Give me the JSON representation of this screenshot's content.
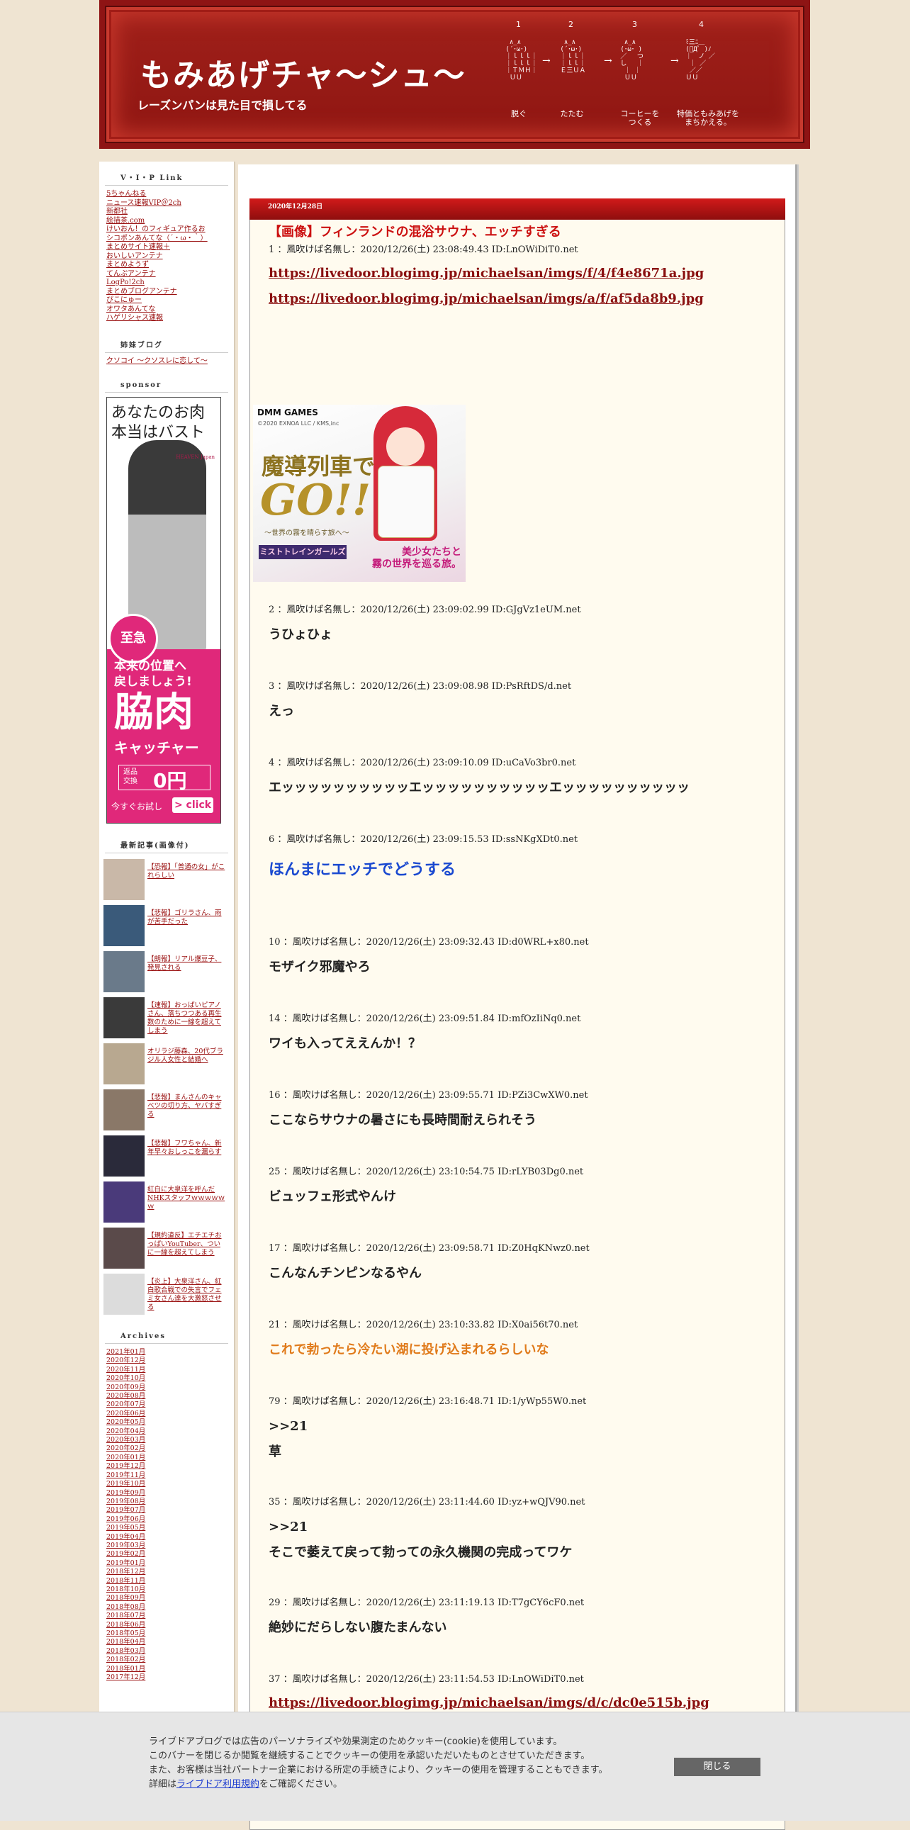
{
  "header": {
    "title": "もみあげチャ～シュ～",
    "subtitle": "レーズンパンは見た目で損してる",
    "steps": [
      {
        "num": "1",
        "caption": "脱ぐ"
      },
      {
        "num": "2",
        "caption": "たたむ"
      },
      {
        "num": "3",
        "caption": "コーヒーを\nつくる"
      },
      {
        "num": "4",
        "caption": "特価ともみあげを\nまちかえる。"
      }
    ]
  },
  "sidebar": {
    "vip_heading": "V・I・P Link",
    "vip_links": [
      "5ちゃんねる",
      "ニュース速報VIP＠2ch",
      "新都社",
      "絵描茶.com",
      "けいおん！のフィギュア作るお",
      "シコポンあんてな（´・ω・｀）",
      "まとめサイト速報＋",
      "おいしいアンテナ",
      "まとめようず",
      "てんぷアンテナ",
      "LogPo!2ch",
      "まとめブログアンテナ",
      "ぴこにゅー",
      "オワタあんてな",
      "ハゲリシャス速報"
    ],
    "sister_heading": "姉妹ブログ",
    "sister_links": [
      "クソコイ ～クソスレに恋して～"
    ],
    "sponsor_heading": "sponsor",
    "sponsor_ad": {
      "top_text": "あなたのお肉\n本当はバスト",
      "brand": "HEAVEN Japan",
      "urgent": "至急",
      "line1": "本来の位置へ\n戻しましょう!",
      "line2": "脇肉",
      "line3": "キャッチャー",
      "return_text": "返品\n交換",
      "return_price": "0円",
      "try_text": "今すぐお試し",
      "click": "click"
    },
    "recent_heading": "最新記事(画像付)",
    "recent": [
      "【恐報】「普通の女」がこれらしい",
      "【悲報】ゴリラさん、雨が苦手だった",
      "【朗報】リアル爆豆子、発見される",
      "【速報】おっぱいピアノさん、落ちつつある再生数のために一線を超えてしまう",
      "オリラジ藤森、20代ブラジル人女性と結婚へ",
      "【悲報】まんさんのキャベツの切り方、ヤバすぎる",
      "【悲報】フワちゃん、新年早々おしっこを漏らす",
      "紅白に大泉洋を呼んだNHKスタッフｗｗｗｗｗｗ",
      "【規約違反】エチエチおっぱいYouTuber、ついに一線を超えてしまう",
      "【炎上】大泉洋さん、紅白歌合戦での失言でフェミ女さん達を大激怒させる"
    ],
    "archives_heading": "Archives",
    "archives": [
      "2021年01月",
      "2020年12月",
      "2020年11月",
      "2020年10月",
      "2020年09月",
      "2020年08月",
      "2020年07月",
      "2020年06月",
      "2020年05月",
      "2020年04月",
      "2020年03月",
      "2020年02月",
      "2020年01月",
      "2019年12月",
      "2019年11月",
      "2019年10月",
      "2019年09月",
      "2019年08月",
      "2019年07月",
      "2019年06月",
      "2019年05月",
      "2019年04月",
      "2019年03月",
      "2019年02月",
      "2019年01月",
      "2018年12月",
      "2018年11月",
      "2018年10月",
      "2018年09月",
      "2018年08月",
      "2018年07月",
      "2018年06月",
      "2018年05月",
      "2018年04月",
      "2018年03月",
      "2018年02月",
      "2018年01月",
      "2017年12月"
    ]
  },
  "entry": {
    "date": "2020年12月28日",
    "title": "【画像】フィンランドの混浴サウナ、エッチすぎる",
    "posts": [
      {
        "meta": "1 ：風吹けば名無し：2020/12/26(土) 23:08:49.43 ID:LnOWiDiT0.net",
        "links": [
          "https://livedoor.blogimg.jp/michaelsan/imgs/f/4/f4e8671a.jpg",
          "https://livedoor.blogimg.jp/michaelsan/imgs/a/f/af5da8b9.jpg"
        ]
      },
      {
        "meta": "2 ：風吹けば名無し：2020/12/26(土) 23:09:02.99 ID:GJgVz1eUM.net",
        "body": "うひょひょ"
      },
      {
        "meta": "3 ：風吹けば名無し：2020/12/26(土) 23:09:08.98 ID:PsRftDS/d.net",
        "body": "えっ"
      },
      {
        "meta": "4 ：風吹けば名無し：2020/12/26(土) 23:09:10.09 ID:uCaVo3br0.net",
        "body": "エッッッッッッッッッッエッッッッッッッッッッエッッッッッッッッッッ"
      },
      {
        "meta": "6 ：風吹けば名無し：2020/12/26(土) 23:09:15.53 ID:ssNKgXDt0.net",
        "body": "ほんまにエッチでどうする"
      },
      {
        "meta": "10 ：風吹けば名無し：2020/12/26(土) 23:09:32.43 ID:d0WRL+x80.net",
        "body": "モザイク邪魔やろ"
      },
      {
        "meta": "14 ：風吹けば名無し：2020/12/26(土) 23:09:51.84 ID:mfOzIiNq0.net",
        "body": "ワイも入ってええんか！？"
      },
      {
        "meta": "16 ：風吹けば名無し：2020/12/26(土) 23:09:55.71 ID:PZi3CwXW0.net",
        "body": "ここならサウナの暑さにも長時間耐えられそう"
      },
      {
        "meta": "25 ：風吹けば名無し：2020/12/26(土) 23:10:54.75 ID:rLYB03Dg0.net",
        "body": "ビュッフェ形式やんけ"
      },
      {
        "meta": "17 ：風吹けば名無し：2020/12/26(土) 23:09:58.71 ID:Z0HqKNwz0.net",
        "body": "こんなんチンピンなるやん"
      },
      {
        "meta": "21 ：風吹けば名無し：2020/12/26(土) 23:10:33.82 ID:X0ai56t70.net",
        "body": "これで勃ったら冷たい湖に投げ込まれるらしいな"
      },
      {
        "meta": "79 ：風吹けば名無し：2020/12/26(土) 23:16:48.71 ID:1/yWp55W0.net",
        "anchor": ">>21",
        "body": "草"
      },
      {
        "meta": "35 ：風吹けば名無し：2020/12/26(土) 23:11:44.60 ID:yz+wQJV90.net",
        "anchor": ">>21",
        "body": "そこで萎えて戻って勃っての永久機関の完成ってワケ"
      },
      {
        "meta": "29 ：風吹けば名無し：2020/12/26(土) 23:11:19.13 ID:T7gCY6cF0.net",
        "body": "絶妙にだらしない腹たまんない"
      },
      {
        "meta": "37 ：風吹けば名無し：2020/12/26(土) 23:11:54.53 ID:LnOWiDiT0.net",
        "links": [
          "https://livedoor.blogimg.jp/michaelsan/imgs/d/c/dc0e515b.jpg"
        ]
      }
    ],
    "game_ad": {
      "brand": "DMM GAMES",
      "copyright": "©2020 EXNOA LLC / KMS,inc",
      "title1": "魔導列車で",
      "title2": "GO!!",
      "subtitle": "～世界の霧を晴らす旅へ～",
      "logo": "ミストトレインガールズ",
      "tagline": "美少女たちと\n霧の世界を巡る旅。"
    }
  },
  "cookie": {
    "line1": "ライブドアブログでは広告のパーソナライズや効果測定のためクッキー(cookie)を使用しています。",
    "line2": "このバナーを閉じるか閲覧を継続することでクッキーの使用を承認いただいたものとさせていただきます。",
    "line3": "また、お客様は当社パートナー企業における所定の手続きにより、クッキーの使用を管理することもできます。",
    "line4_pre": "詳細は",
    "line4_link": "ライブドア利用規約",
    "line4_post": "をご確認ください。",
    "close_label": "閉じる"
  },
  "colors": {
    "header_red": "#8e1414",
    "title_red": "#cc1111",
    "link_red": "#8a1010",
    "blue_text": "#1a49d0",
    "orange_text": "#e07a1a",
    "page_bg": "#efe4d2"
  }
}
